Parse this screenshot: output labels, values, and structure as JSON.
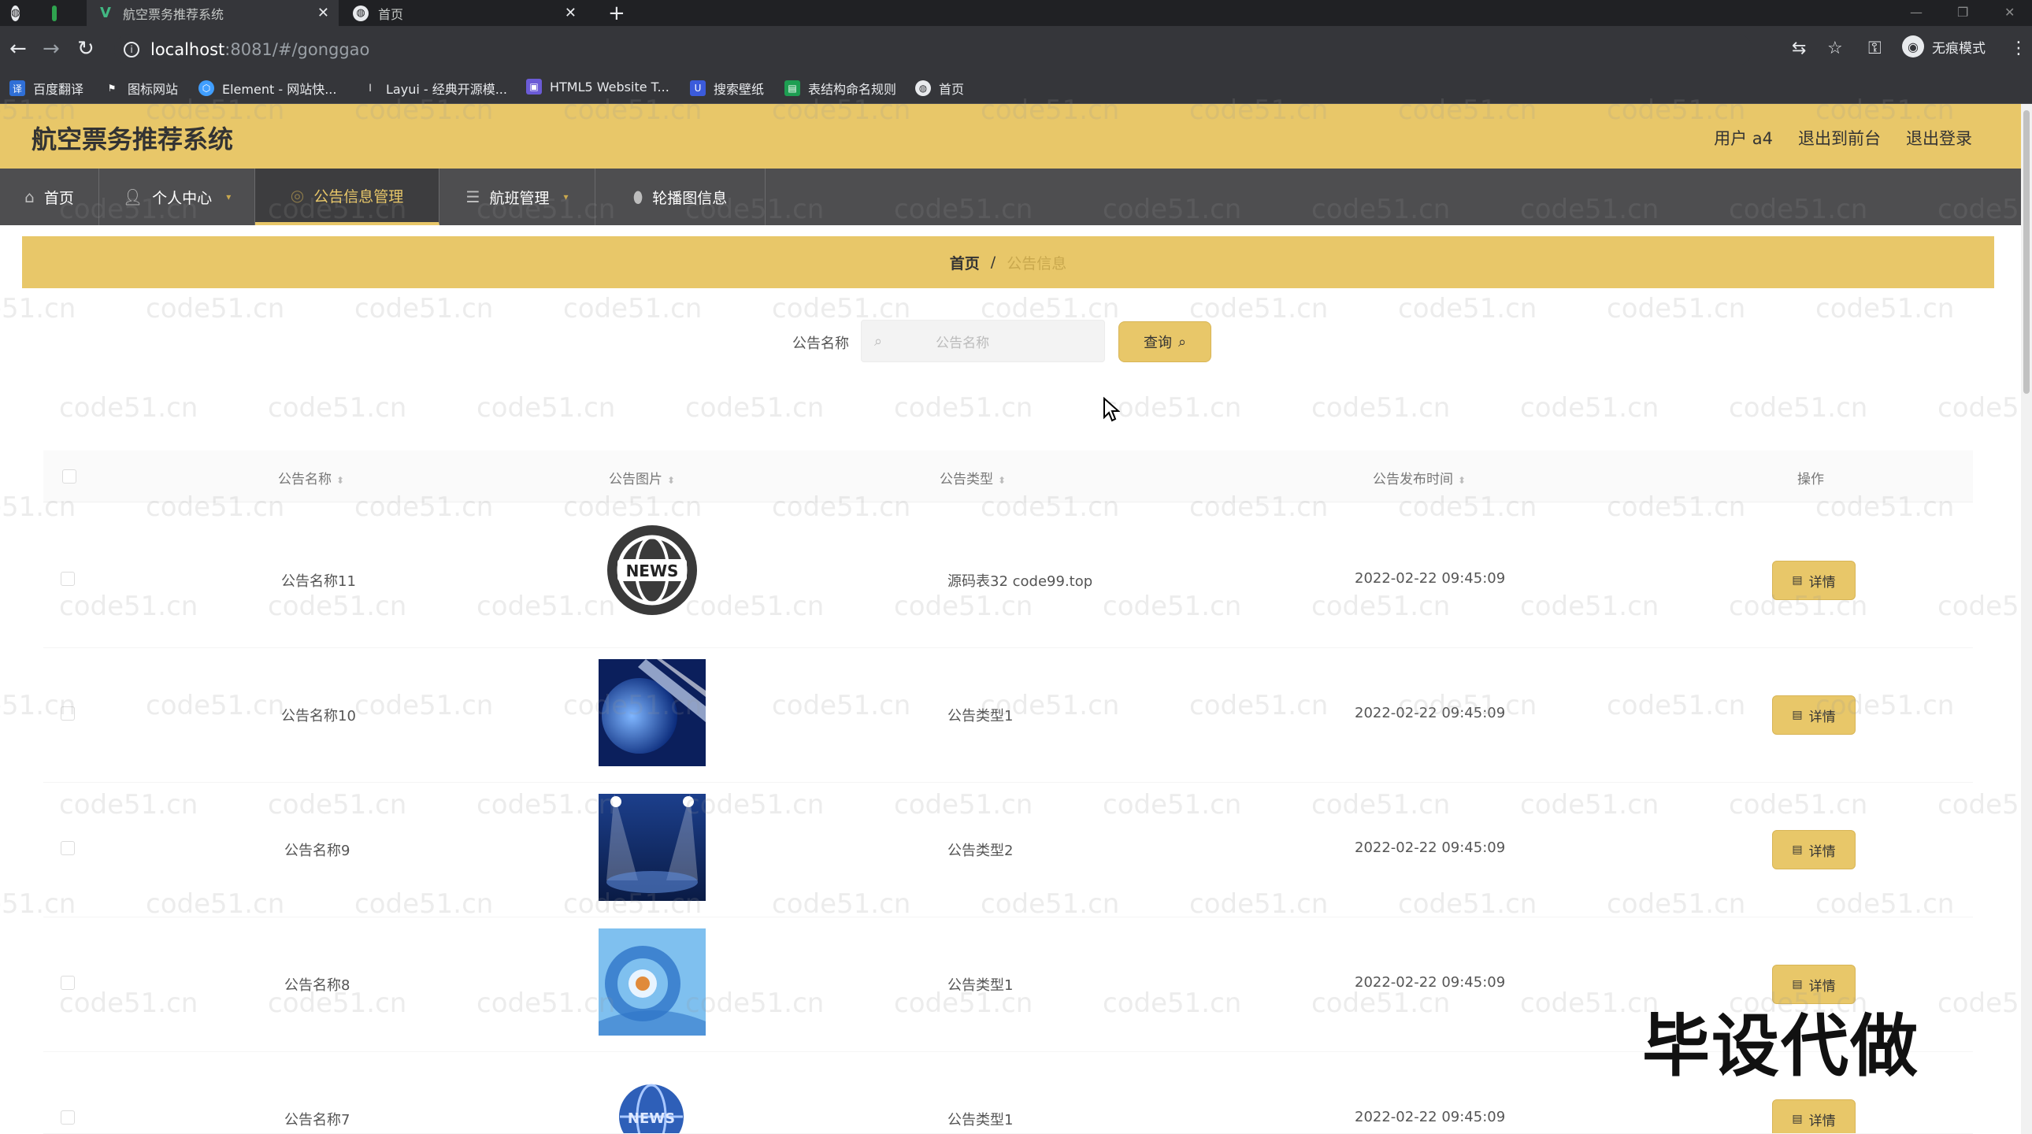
{
  "browser": {
    "tabs": [
      {
        "title": "航空票务推荐系统",
        "active": true
      },
      {
        "title": "首页",
        "active": false
      }
    ],
    "url_host": "localhost",
    "url_path": ":8081/#/gonggao",
    "profile_label": "无痕模式",
    "bookmarks": [
      "百度翻译",
      "图标网站",
      "Element - 网站快...",
      "Layui - 经典开源模...",
      "HTML5 Website T...",
      "搜索壁纸",
      "表结构命名规则",
      "首页"
    ]
  },
  "app": {
    "title": "航空票务推荐系统",
    "user_label": "用户 a4",
    "to_front_label": "退出到前台",
    "logout_label": "退出登录",
    "accent_color": "#e8c769"
  },
  "menu": [
    {
      "label": "首页",
      "icon": "home-icon"
    },
    {
      "label": "个人中心",
      "icon": "user-icon"
    },
    {
      "label": "公告信息管理",
      "icon": "notice-icon"
    },
    {
      "label": "航班管理",
      "icon": "list-icon"
    },
    {
      "label": "轮播图信息",
      "icon": "image-icon"
    }
  ],
  "breadcrumb": {
    "home": "首页",
    "separator": "/",
    "current": "公告信息"
  },
  "search": {
    "label": "公告名称",
    "placeholder": "公告名称",
    "button_label": "查询"
  },
  "table": {
    "headers": [
      "公告名称",
      "公告图片",
      "公告类型",
      "公告发布时间",
      "操作"
    ],
    "detail_label": "详情",
    "rows": [
      {
        "name": "公告名称11",
        "type": "源码表32 code99.top",
        "time": "2022-02-22 09:45:09",
        "image": "news-globe-badge"
      },
      {
        "name": "公告名称10",
        "type": "公告类型1",
        "time": "2022-02-22 09:45:09",
        "image": "blue-globe"
      },
      {
        "name": "公告名称9",
        "type": "公告类型2",
        "time": "2022-02-22 09:45:09",
        "image": "spotlight-stage"
      },
      {
        "name": "公告名称8",
        "type": "公告类型1",
        "time": "2022-02-22 09:45:09",
        "image": "blue-news-swirl"
      },
      {
        "name": "公告名称7",
        "type": "公告类型1",
        "time": "2022-02-22 09:45:09",
        "image": "news-globe-small"
      }
    ]
  },
  "watermark_text": "code51.cn",
  "promo_text": "毕设代做"
}
